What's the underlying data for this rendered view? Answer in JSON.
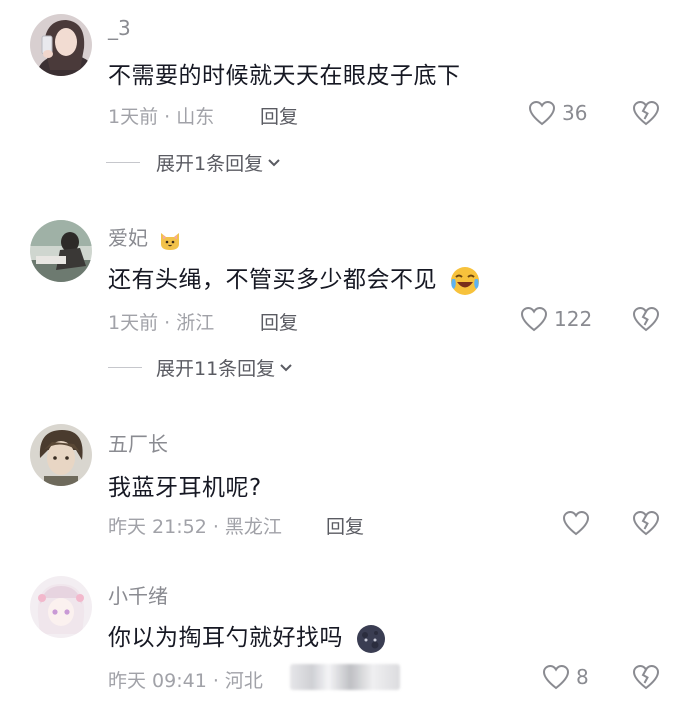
{
  "comments": [
    {
      "username": "_3",
      "text": "不需要的时候就天天在眼皮子底下",
      "time_location": "1天前 · 山东",
      "reply_label": "回复",
      "likes": "36",
      "expand_label": "展开1条回复",
      "avatar_icon": "avatar-woman-selfie"
    },
    {
      "username": "爱妃",
      "text": "还有头绳，不管买多少都会不见",
      "time_location": "1天前 · 浙江",
      "reply_label": "回复",
      "likes": "122",
      "expand_label": "展开11条回复",
      "avatar_icon": "avatar-person-outdoor"
    },
    {
      "username": "五厂长",
      "text": "我蓝牙耳机呢?",
      "time_location": "昨天 21:52 · 黑龙江",
      "reply_label": "回复",
      "likes": "",
      "avatar_icon": "avatar-anime-man"
    },
    {
      "username": "小千绪",
      "text": "你以为掏耳勺就好找吗",
      "time_location": "昨天 09:41 · 河北",
      "reply_label": "",
      "likes": "8",
      "avatar_icon": "avatar-anime-girl"
    }
  ],
  "colors": {
    "text": "#161823",
    "secondary": "#8a8b91",
    "meta": "#a1a2a8",
    "reply": "#5a5b62"
  }
}
